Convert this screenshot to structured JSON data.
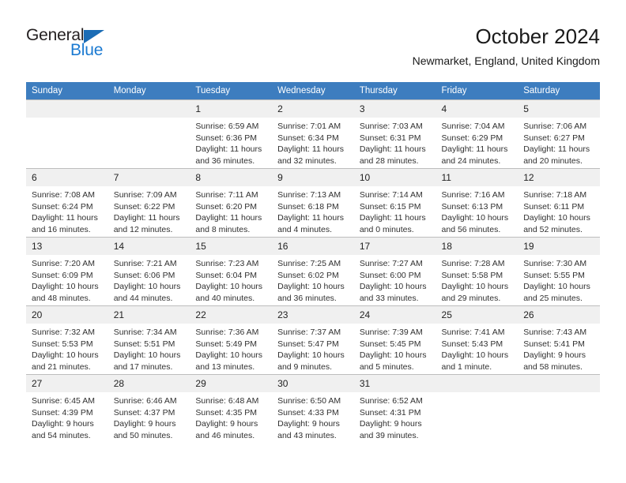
{
  "brand": {
    "name_part1": "General",
    "name_part2": "Blue",
    "triangle_icon": "triangle-icon",
    "colors": {
      "dark": "#231f20",
      "blue": "#1b7ad1",
      "triangle": "#1b6cb5"
    }
  },
  "header": {
    "title": "October 2024",
    "subtitle": "Newmarket, England, United Kingdom",
    "header_bg": "#3d7dbf"
  },
  "weekday_headers": [
    "Sunday",
    "Monday",
    "Tuesday",
    "Wednesday",
    "Thursday",
    "Friday",
    "Saturday"
  ],
  "weeks": [
    [
      {
        "day": "",
        "sunrise": "",
        "sunset": "",
        "daylight1": "",
        "daylight2": "",
        "empty": true
      },
      {
        "day": "",
        "sunrise": "",
        "sunset": "",
        "daylight1": "",
        "daylight2": "",
        "empty": true
      },
      {
        "day": "1",
        "sunrise": "Sunrise: 6:59 AM",
        "sunset": "Sunset: 6:36 PM",
        "daylight1": "Daylight: 11 hours",
        "daylight2": "and 36 minutes."
      },
      {
        "day": "2",
        "sunrise": "Sunrise: 7:01 AM",
        "sunset": "Sunset: 6:34 PM",
        "daylight1": "Daylight: 11 hours",
        "daylight2": "and 32 minutes."
      },
      {
        "day": "3",
        "sunrise": "Sunrise: 7:03 AM",
        "sunset": "Sunset: 6:31 PM",
        "daylight1": "Daylight: 11 hours",
        "daylight2": "and 28 minutes."
      },
      {
        "day": "4",
        "sunrise": "Sunrise: 7:04 AM",
        "sunset": "Sunset: 6:29 PM",
        "daylight1": "Daylight: 11 hours",
        "daylight2": "and 24 minutes."
      },
      {
        "day": "5",
        "sunrise": "Sunrise: 7:06 AM",
        "sunset": "Sunset: 6:27 PM",
        "daylight1": "Daylight: 11 hours",
        "daylight2": "and 20 minutes."
      }
    ],
    [
      {
        "day": "6",
        "sunrise": "Sunrise: 7:08 AM",
        "sunset": "Sunset: 6:24 PM",
        "daylight1": "Daylight: 11 hours",
        "daylight2": "and 16 minutes."
      },
      {
        "day": "7",
        "sunrise": "Sunrise: 7:09 AM",
        "sunset": "Sunset: 6:22 PM",
        "daylight1": "Daylight: 11 hours",
        "daylight2": "and 12 minutes."
      },
      {
        "day": "8",
        "sunrise": "Sunrise: 7:11 AM",
        "sunset": "Sunset: 6:20 PM",
        "daylight1": "Daylight: 11 hours",
        "daylight2": "and 8 minutes."
      },
      {
        "day": "9",
        "sunrise": "Sunrise: 7:13 AM",
        "sunset": "Sunset: 6:18 PM",
        "daylight1": "Daylight: 11 hours",
        "daylight2": "and 4 minutes."
      },
      {
        "day": "10",
        "sunrise": "Sunrise: 7:14 AM",
        "sunset": "Sunset: 6:15 PM",
        "daylight1": "Daylight: 11 hours",
        "daylight2": "and 0 minutes."
      },
      {
        "day": "11",
        "sunrise": "Sunrise: 7:16 AM",
        "sunset": "Sunset: 6:13 PM",
        "daylight1": "Daylight: 10 hours",
        "daylight2": "and 56 minutes."
      },
      {
        "day": "12",
        "sunrise": "Sunrise: 7:18 AM",
        "sunset": "Sunset: 6:11 PM",
        "daylight1": "Daylight: 10 hours",
        "daylight2": "and 52 minutes."
      }
    ],
    [
      {
        "day": "13",
        "sunrise": "Sunrise: 7:20 AM",
        "sunset": "Sunset: 6:09 PM",
        "daylight1": "Daylight: 10 hours",
        "daylight2": "and 48 minutes."
      },
      {
        "day": "14",
        "sunrise": "Sunrise: 7:21 AM",
        "sunset": "Sunset: 6:06 PM",
        "daylight1": "Daylight: 10 hours",
        "daylight2": "and 44 minutes."
      },
      {
        "day": "15",
        "sunrise": "Sunrise: 7:23 AM",
        "sunset": "Sunset: 6:04 PM",
        "daylight1": "Daylight: 10 hours",
        "daylight2": "and 40 minutes."
      },
      {
        "day": "16",
        "sunrise": "Sunrise: 7:25 AM",
        "sunset": "Sunset: 6:02 PM",
        "daylight1": "Daylight: 10 hours",
        "daylight2": "and 36 minutes."
      },
      {
        "day": "17",
        "sunrise": "Sunrise: 7:27 AM",
        "sunset": "Sunset: 6:00 PM",
        "daylight1": "Daylight: 10 hours",
        "daylight2": "and 33 minutes."
      },
      {
        "day": "18",
        "sunrise": "Sunrise: 7:28 AM",
        "sunset": "Sunset: 5:58 PM",
        "daylight1": "Daylight: 10 hours",
        "daylight2": "and 29 minutes."
      },
      {
        "day": "19",
        "sunrise": "Sunrise: 7:30 AM",
        "sunset": "Sunset: 5:55 PM",
        "daylight1": "Daylight: 10 hours",
        "daylight2": "and 25 minutes."
      }
    ],
    [
      {
        "day": "20",
        "sunrise": "Sunrise: 7:32 AM",
        "sunset": "Sunset: 5:53 PM",
        "daylight1": "Daylight: 10 hours",
        "daylight2": "and 21 minutes."
      },
      {
        "day": "21",
        "sunrise": "Sunrise: 7:34 AM",
        "sunset": "Sunset: 5:51 PM",
        "daylight1": "Daylight: 10 hours",
        "daylight2": "and 17 minutes."
      },
      {
        "day": "22",
        "sunrise": "Sunrise: 7:36 AM",
        "sunset": "Sunset: 5:49 PM",
        "daylight1": "Daylight: 10 hours",
        "daylight2": "and 13 minutes."
      },
      {
        "day": "23",
        "sunrise": "Sunrise: 7:37 AM",
        "sunset": "Sunset: 5:47 PM",
        "daylight1": "Daylight: 10 hours",
        "daylight2": "and 9 minutes."
      },
      {
        "day": "24",
        "sunrise": "Sunrise: 7:39 AM",
        "sunset": "Sunset: 5:45 PM",
        "daylight1": "Daylight: 10 hours",
        "daylight2": "and 5 minutes."
      },
      {
        "day": "25",
        "sunrise": "Sunrise: 7:41 AM",
        "sunset": "Sunset: 5:43 PM",
        "daylight1": "Daylight: 10 hours",
        "daylight2": "and 1 minute."
      },
      {
        "day": "26",
        "sunrise": "Sunrise: 7:43 AM",
        "sunset": "Sunset: 5:41 PM",
        "daylight1": "Daylight: 9 hours",
        "daylight2": "and 58 minutes."
      }
    ],
    [
      {
        "day": "27",
        "sunrise": "Sunrise: 6:45 AM",
        "sunset": "Sunset: 4:39 PM",
        "daylight1": "Daylight: 9 hours",
        "daylight2": "and 54 minutes."
      },
      {
        "day": "28",
        "sunrise": "Sunrise: 6:46 AM",
        "sunset": "Sunset: 4:37 PM",
        "daylight1": "Daylight: 9 hours",
        "daylight2": "and 50 minutes."
      },
      {
        "day": "29",
        "sunrise": "Sunrise: 6:48 AM",
        "sunset": "Sunset: 4:35 PM",
        "daylight1": "Daylight: 9 hours",
        "daylight2": "and 46 minutes."
      },
      {
        "day": "30",
        "sunrise": "Sunrise: 6:50 AM",
        "sunset": "Sunset: 4:33 PM",
        "daylight1": "Daylight: 9 hours",
        "daylight2": "and 43 minutes."
      },
      {
        "day": "31",
        "sunrise": "Sunrise: 6:52 AM",
        "sunset": "Sunset: 4:31 PM",
        "daylight1": "Daylight: 9 hours",
        "daylight2": "and 39 minutes."
      },
      {
        "day": "",
        "sunrise": "",
        "sunset": "",
        "daylight1": "",
        "daylight2": "",
        "empty": true
      },
      {
        "day": "",
        "sunrise": "",
        "sunset": "",
        "daylight1": "",
        "daylight2": "",
        "empty": true
      }
    ]
  ]
}
